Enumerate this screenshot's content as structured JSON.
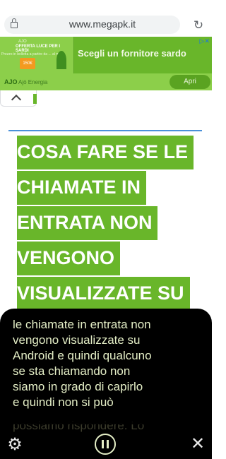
{
  "browser": {
    "url": "www.megapk.it",
    "lock_icon": "lock-icon",
    "reload_icon": "reload-icon"
  },
  "ad": {
    "image_text_1": "AJO",
    "image_text_2": "OFFERTA LUCE PER I SARDI",
    "image_text_3": "Prezzo in bolletta a partire da ... al mese",
    "image_badge": "150€",
    "headline": "Scegli un fornitore sardo",
    "logo": "AJO",
    "advertiser": "Ajò Energia",
    "cta": "Apri",
    "colors": {
      "ad_green": "#69b62a",
      "ad_light_green": "#8ccf4a"
    }
  },
  "article": {
    "headline_lines": [
      "COSA FARE SE LE",
      "CHIAMATE IN",
      "ENTRATA NON",
      "VENGONO",
      "VISUALIZZATE SU"
    ],
    "highlight_color": "#69b62a"
  },
  "reader": {
    "text_lines": [
      "le chiamate in entrata non",
      "vengono visualizzate su",
      "Android e quindi qualcuno",
      "se sta chiamando non",
      "siamo in grado di capirlo",
      "e quindi non si può"
    ],
    "ghost_line": "possiamo rispondere. Lo",
    "controls": {
      "settings_icon": "gear-icon",
      "pause_icon": "pause-icon",
      "close_icon": "close-icon"
    }
  }
}
